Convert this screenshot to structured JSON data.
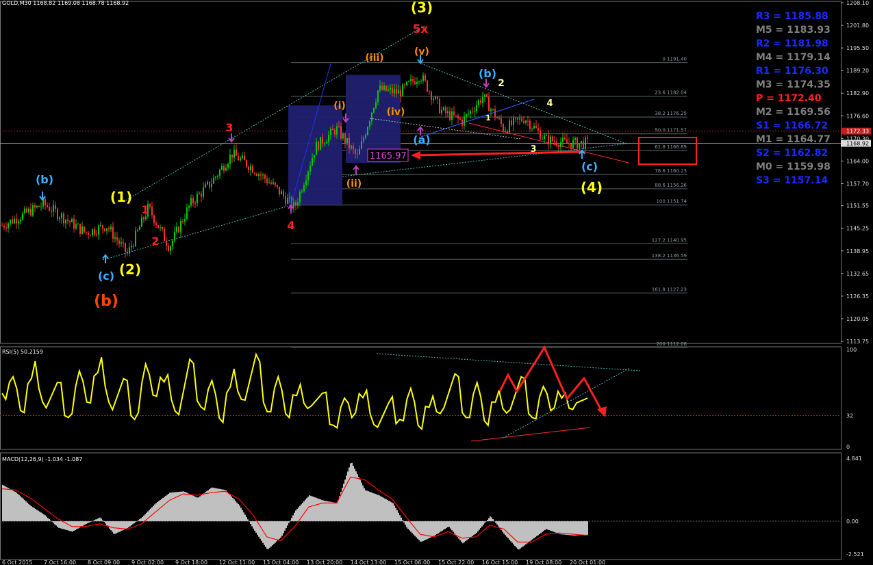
{
  "header": {
    "main": "GOLD,M30  1168.82 1169.08 1168.78 1168.92",
    "rsi": "RSI(5) 50.2159",
    "macd": "MACD(12,26,9) -1.034 -1.087"
  },
  "colors": {
    "up": "#00cc00",
    "down": "#ff3030",
    "rsi": "#ffff00",
    "macd_hist": "#c0c0c0",
    "macd_signal": "#ff0000",
    "grid": "#3a3a3a",
    "fib": "#5a6a6a"
  },
  "pivots": [
    {
      "label": "R3 = 1185.88",
      "color": "#1a2bff"
    },
    {
      "label": "M5 = 1183.93",
      "color": "#808080"
    },
    {
      "label": "R2 = 1181.98",
      "color": "#1a2bff"
    },
    {
      "label": "M4 = 1179.14",
      "color": "#808080"
    },
    {
      "label": "R1 = 1176.30",
      "color": "#1a2bff"
    },
    {
      "label": "M3 = 1174.35",
      "color": "#808080"
    },
    {
      "label": "P   = 1172.40",
      "color": "#ff2020"
    },
    {
      "label": "M2 = 1169.56",
      "color": "#808080"
    },
    {
      "label": "S1 = 1166.72",
      "color": "#1a2bff"
    },
    {
      "label": "M1 = 1164.77",
      "color": "#808080"
    },
    {
      "label": "S2 = 1162.82",
      "color": "#1a2bff"
    },
    {
      "label": "M0 = 1159.98",
      "color": "#808080"
    },
    {
      "label": "S3 = 1157.14",
      "color": "#1a2bff"
    }
  ],
  "price_axis": [
    "1208.10",
    "1201.80",
    "1195.50",
    "1189.20",
    "1182.90",
    "1176.60",
    "1170.30",
    "1164.00",
    "1157.70",
    "1151.55",
    "1145.25",
    "1138.95",
    "1132.65",
    "1126.35",
    "1120.05",
    "1113.75"
  ],
  "price_current": "1168.92",
  "price_level": "1172.33",
  "fib_labels": [
    "0 1191.40",
    "23.6 1182.04",
    "38.2 1176.25",
    "50.0 1171.57",
    "61.8 1166.89",
    "78.6 1160.23",
    "88.6 1156.26",
    "100 1151.74",
    "127.2 1140.95",
    "138.2 1136.59",
    "161.8 1127.23",
    "200 1112.08"
  ],
  "price_callout": "1165.97",
  "rsi_axis": [
    "100",
    "32",
    "0"
  ],
  "macd_axis": [
    "4.841",
    "0.00",
    "-2.521"
  ],
  "time_axis": [
    "6 Oct 2015",
    "7 Oct 16:00",
    "8 Oct 09:00",
    "9 Oct 02:00",
    "9 Oct 18:00",
    "12 Oct 11:00",
    "13 Oct 04:00",
    "13 Oct 20:00",
    "14 Oct 13:00",
    "15 Oct 06:00",
    "15 Oct 22:00",
    "16 Oct 15:00",
    "19 Oct 08:00",
    "20 Oct 01:00"
  ],
  "wave_labels": [
    {
      "text": "(3)",
      "color": "#ffff00"
    },
    {
      "text": "5x",
      "color": "#ff2020"
    },
    {
      "text": "(v)",
      "color": "#ff8c00"
    },
    {
      "text": "(iii)",
      "color": "#ff8c00"
    },
    {
      "text": "(i)",
      "color": "#ff8c00"
    },
    {
      "text": "(iv)",
      "color": "#ff8c00"
    },
    {
      "text": "(ii)",
      "color": "#ff8c00"
    },
    {
      "text": "(b)",
      "color": "#3ab0ff"
    },
    {
      "text": "2",
      "color": "#ffff99"
    },
    {
      "text": "4",
      "color": "#ffff99"
    },
    {
      "text": "1",
      "color": "#ffff99"
    },
    {
      "text": "3",
      "color": "#ffff99"
    },
    {
      "text": "(a)",
      "color": "#3ab0ff"
    },
    {
      "text": "(c)",
      "color": "#3ab0ff"
    },
    {
      "text": "(4)",
      "color": "#ffff00"
    },
    {
      "text": "3",
      "color": "#ff2020"
    },
    {
      "text": "4",
      "color": "#ff2020"
    },
    {
      "text": "1",
      "color": "#ff2020"
    },
    {
      "text": "2",
      "color": "#ff2020"
    },
    {
      "text": "(1)",
      "color": "#ffff00"
    },
    {
      "text": "(2)",
      "color": "#ffff00"
    },
    {
      "text": "(b)",
      "color": "#3ab0ff"
    },
    {
      "text": "(c)",
      "color": "#3ab0ff"
    },
    {
      "text": "(b)",
      "color": "#ff4500"
    }
  ],
  "chart_data": [
    {
      "type": "candlestick",
      "title": "GOLD,M30",
      "ylim": [
        1113.75,
        1208.1
      ],
      "close_path": [
        {
          "x": "6 Oct 2015",
          "y": 1146
        },
        {
          "x": "7 Oct 04:00",
          "y": 1149
        },
        {
          "x": "7 Oct 12:00",
          "y": 1152
        },
        {
          "x": "7 Oct 16:00",
          "y": 1148
        },
        {
          "x": "8 Oct 01:00",
          "y": 1144
        },
        {
          "x": "8 Oct 06:00",
          "y": 1146
        },
        {
          "x": "8 Oct 09:00",
          "y": 1138
        },
        {
          "x": "8 Oct 16:00",
          "y": 1151
        },
        {
          "x": "9 Oct 02:00",
          "y": 1140
        },
        {
          "x": "9 Oct 10:00",
          "y": 1152
        },
        {
          "x": "9 Oct 18:00",
          "y": 1158
        },
        {
          "x": "12 Oct 05:00",
          "y": 1166
        },
        {
          "x": "12 Oct 11:00",
          "y": 1162
        },
        {
          "x": "12 Oct 20:00",
          "y": 1157
        },
        {
          "x": "13 Oct 04:00",
          "y": 1151
        },
        {
          "x": "13 Oct 12:00",
          "y": 1168
        },
        {
          "x": "13 Oct 20:00",
          "y": 1173
        },
        {
          "x": "14 Oct 04:00",
          "y": 1165
        },
        {
          "x": "14 Oct 13:00",
          "y": 1184
        },
        {
          "x": "14 Oct 20:00",
          "y": 1183
        },
        {
          "x": "15 Oct 06:00",
          "y": 1188
        },
        {
          "x": "15 Oct 12:00",
          "y": 1178
        },
        {
          "x": "15 Oct 22:00",
          "y": 1175
        },
        {
          "x": "16 Oct 06:00",
          "y": 1182
        },
        {
          "x": "16 Oct 15:00",
          "y": 1173
        },
        {
          "x": "19 Oct 01:00",
          "y": 1176
        },
        {
          "x": "19 Oct 08:00",
          "y": 1170
        },
        {
          "x": "19 Oct 18:00",
          "y": 1169
        },
        {
          "x": "20 Oct 01:00",
          "y": 1168.92
        }
      ]
    },
    {
      "type": "line",
      "title": "RSI(5) 50.2159",
      "ylim": [
        0,
        100
      ],
      "series": [
        {
          "values": [
            55,
            72,
            35,
            88,
            40,
            66,
            30,
            78,
            45,
            92,
            38,
            70,
            28,
            85,
            52,
            74,
            33,
            90,
            41,
            68,
            25,
            80,
            48,
            95,
            36,
            72,
            30,
            64,
            42,
            55,
            22,
            50,
            35,
            58,
            20,
            45,
            28,
            60,
            18,
            52,
            40,
            75,
            30,
            66,
            22,
            58,
            38,
            72,
            30,
            62,
            40,
            55,
            45,
            50
          ]
        }
      ]
    },
    {
      "type": "area",
      "title": "MACD(12,26,9) -1.034 -1.087",
      "ylim": [
        -2.521,
        4.841
      ],
      "series": [
        {
          "values": [
            2.8,
            2.2,
            1.2,
            0.5,
            -0.5,
            -0.8,
            -0.2,
            0.3,
            -1.0,
            -0.5,
            0.3,
            1.4,
            2.2,
            2.3,
            1.8,
            2.6,
            2.4,
            1.2,
            -0.6,
            -2.2,
            -1.2,
            0.8,
            2.0,
            1.6,
            1.4,
            4.6,
            2.4,
            2.0,
            1.4,
            -0.5,
            -1.6,
            -1.1,
            -0.4,
            -1.7,
            -0.9,
            0.4,
            -1.0,
            -2.2,
            -1.4,
            -0.6,
            -1.0,
            -1.1,
            -1.034
          ]
        },
        {
          "values": [
            2.5,
            2.4,
            1.8,
            1.0,
            0.2,
            -0.4,
            -0.4,
            -0.2,
            -0.5,
            -0.6,
            -0.2,
            0.7,
            1.6,
            2.1,
            2.0,
            2.2,
            2.3,
            1.7,
            0.5,
            -1.2,
            -1.5,
            -0.4,
            1.1,
            1.4,
            1.4,
            3.4,
            3.2,
            2.4,
            1.7,
            0.3,
            -1.0,
            -1.2,
            -0.8,
            -1.3,
            -1.2,
            -0.3,
            -0.6,
            -1.6,
            -1.6,
            -1.0,
            -0.9,
            -1.0,
            -1.087
          ]
        }
      ]
    }
  ]
}
